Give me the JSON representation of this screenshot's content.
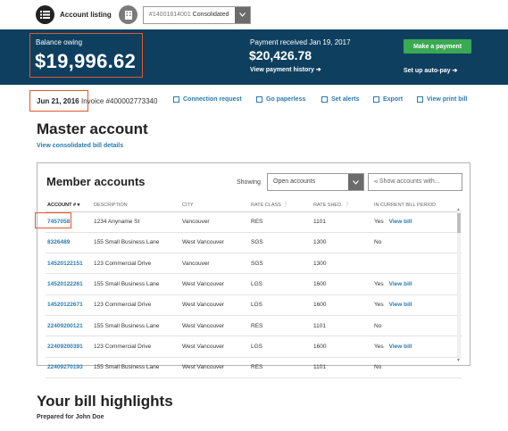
{
  "topbar": {
    "account_listing_label": "Account listing",
    "account_select_number": "#14001814001",
    "account_select_value": "Consolidated"
  },
  "balance": {
    "label": "Balance owing",
    "amount": "$19,996.62"
  },
  "payment": {
    "received_label": "Payment received Jan 19, 2017",
    "amount": "$20,426.78",
    "history_link": "View payment history ➔",
    "make_payment_label": "Make a payment",
    "autopay_link": "Set up auto-pay ➔"
  },
  "invoice": {
    "date": "Jun 21, 2016",
    "number": "Invoice #400002773340"
  },
  "actions": [
    {
      "label": "Connection request",
      "icon": "connection-icon"
    },
    {
      "label": "Go paperless",
      "icon": "paperless-icon"
    },
    {
      "label": "Set alerts",
      "icon": "alert-icon"
    },
    {
      "label": "Export",
      "icon": "export-icon"
    },
    {
      "label": "View print bill",
      "icon": "print-icon"
    }
  ],
  "master": {
    "title": "Master account",
    "consolidated_link": "View consolidated bill details"
  },
  "member_accounts": {
    "title": "Member accounts",
    "showing_label": "Showing",
    "filter_value": "Open accounts",
    "search_placeholder": "Show accounts with...",
    "columns": [
      "ACCOUNT #",
      "DESCRIPTION",
      "CITY",
      "RATE CLASS",
      "RATE SHED.",
      "IN CURRENT BILL PERIOD"
    ],
    "rows": [
      {
        "account": "7457058",
        "description": "1234 Anyname St",
        "city": "Vancouver",
        "rate_class": "RES",
        "rate_shed": "1101",
        "in_period": "Yes",
        "link": "View bill"
      },
      {
        "account": "8326489",
        "description": "155 Small Business Lane",
        "city": "West Vancouver",
        "rate_class": "SGS",
        "rate_shed": "1300",
        "in_period": "No",
        "link": ""
      },
      {
        "account": "14520122151",
        "description": "123 Commercial Drive",
        "city": "Vancouver",
        "rate_class": "SGS",
        "rate_shed": "1300",
        "in_period": "",
        "link": ""
      },
      {
        "account": "14520122261",
        "description": "155 Small Business Lane",
        "city": "West Vancouver",
        "rate_class": "LGS",
        "rate_shed": "1600",
        "in_period": "Yes",
        "link": "View bill"
      },
      {
        "account": "14520122671",
        "description": "123 Commercial Drive",
        "city": "West Vancouver",
        "rate_class": "LGS",
        "rate_shed": "1600",
        "in_period": "Yes",
        "link": "View bill"
      },
      {
        "account": "22409200121",
        "description": "155 Small Business Lane",
        "city": "West Vancouver",
        "rate_class": "RES",
        "rate_shed": "1101",
        "in_period": "No",
        "link": ""
      },
      {
        "account": "22409200391",
        "description": "123 Commercial Drive",
        "city": "West Vancouver",
        "rate_class": "LGS",
        "rate_shed": "1600",
        "in_period": "Yes",
        "link": "View bill"
      },
      {
        "account": "22409270193",
        "description": "155 Small Business Lane",
        "city": "West Vancouver",
        "rate_class": "RES",
        "rate_shed": "1101",
        "in_period": "No",
        "link": ""
      }
    ]
  },
  "highlights": {
    "title": "Your bill highlights",
    "prepared_for": "Prepared for John Doe"
  },
  "colors": {
    "banner": "#0e3f5f",
    "accent_link": "#2b7bb0",
    "payment_button": "#3aa952",
    "highlight_box": "#e2572b"
  }
}
